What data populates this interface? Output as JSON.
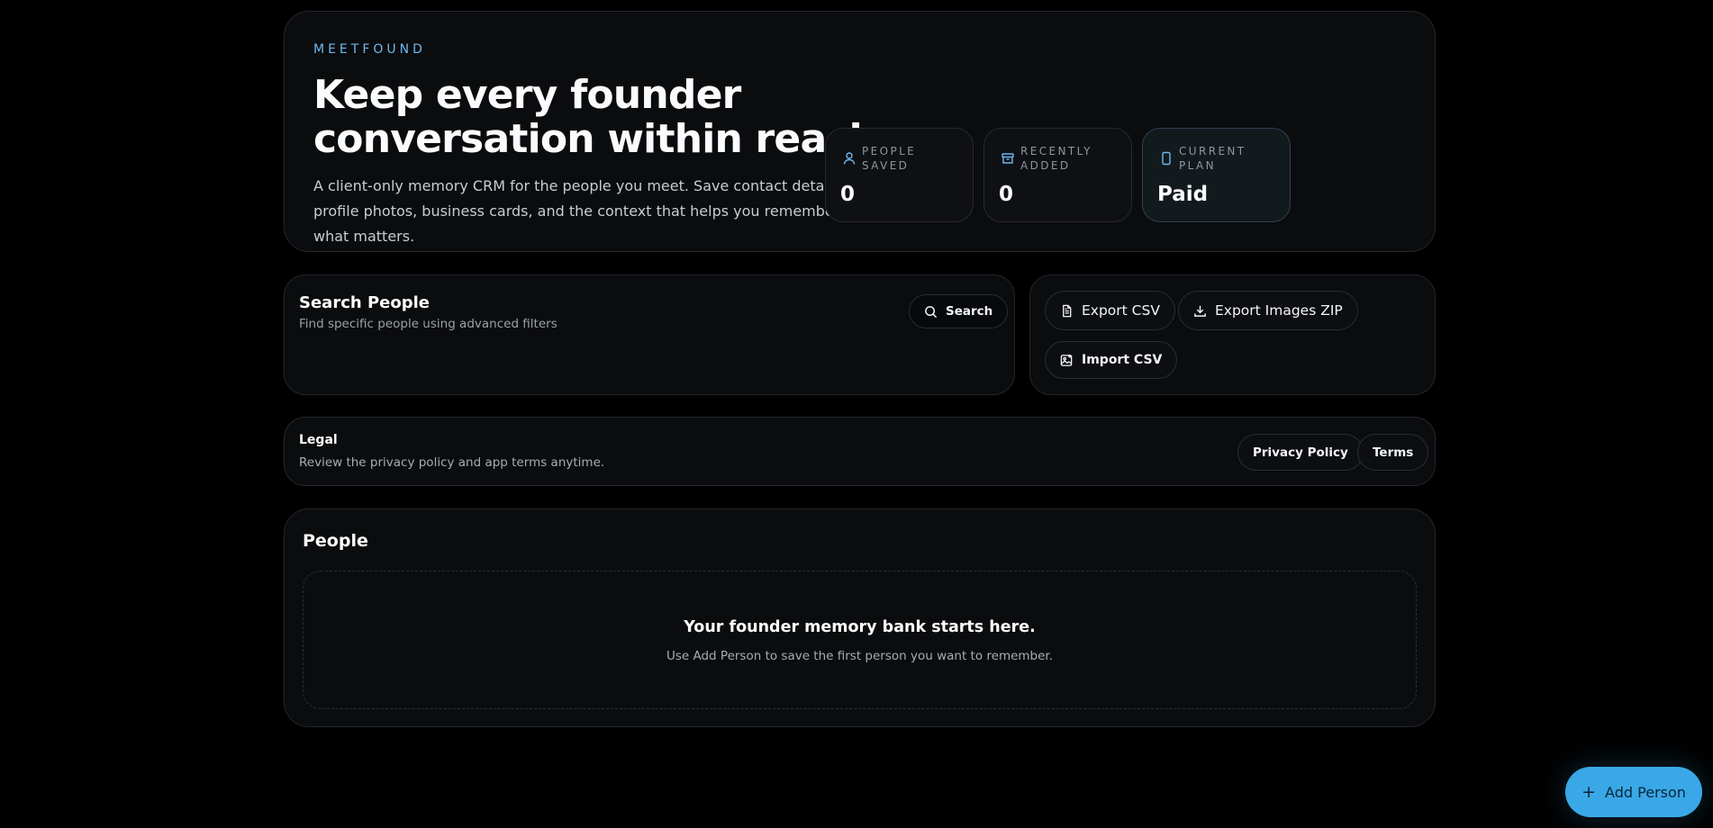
{
  "brand": "MEETFOUND",
  "hero": {
    "title_line1": "Keep every founder",
    "title_line2": "conversation within reach.",
    "description": "A client-only memory CRM for the people you meet. Save contact details, profile photos, business cards, and the context that helps you remember what matters."
  },
  "stats": [
    {
      "label": "PEOPLE SAVED",
      "value": "0",
      "icon": "person-icon"
    },
    {
      "label": "RECENTLY ADDED",
      "value": "0",
      "icon": "archive-icon"
    },
    {
      "label": "CURRENT PLAN",
      "value": "Paid",
      "icon": "phone-icon"
    }
  ],
  "search": {
    "title": "Search People",
    "subtitle": "Find specific people using advanced filters",
    "button_label": "Search"
  },
  "actions": {
    "export_csv": "Export CSV",
    "export_zip": "Export Images ZIP",
    "import_csv": "Import CSV"
  },
  "legal": {
    "title": "Legal",
    "subtitle": "Review the privacy policy and app terms anytime.",
    "privacy_label": "Privacy Policy",
    "terms_label": "Terms"
  },
  "people": {
    "title": "People",
    "empty_title": "Your founder memory bank starts here.",
    "empty_subtitle": "Use Add Person to save the first person you want to remember."
  },
  "fab": {
    "icon": "+",
    "label": "Add Person"
  },
  "colors": {
    "accent": "#3aa8e6",
    "eyebrow": "#6cb8f0",
    "background": "#000000",
    "card": "#0b0c0e"
  }
}
